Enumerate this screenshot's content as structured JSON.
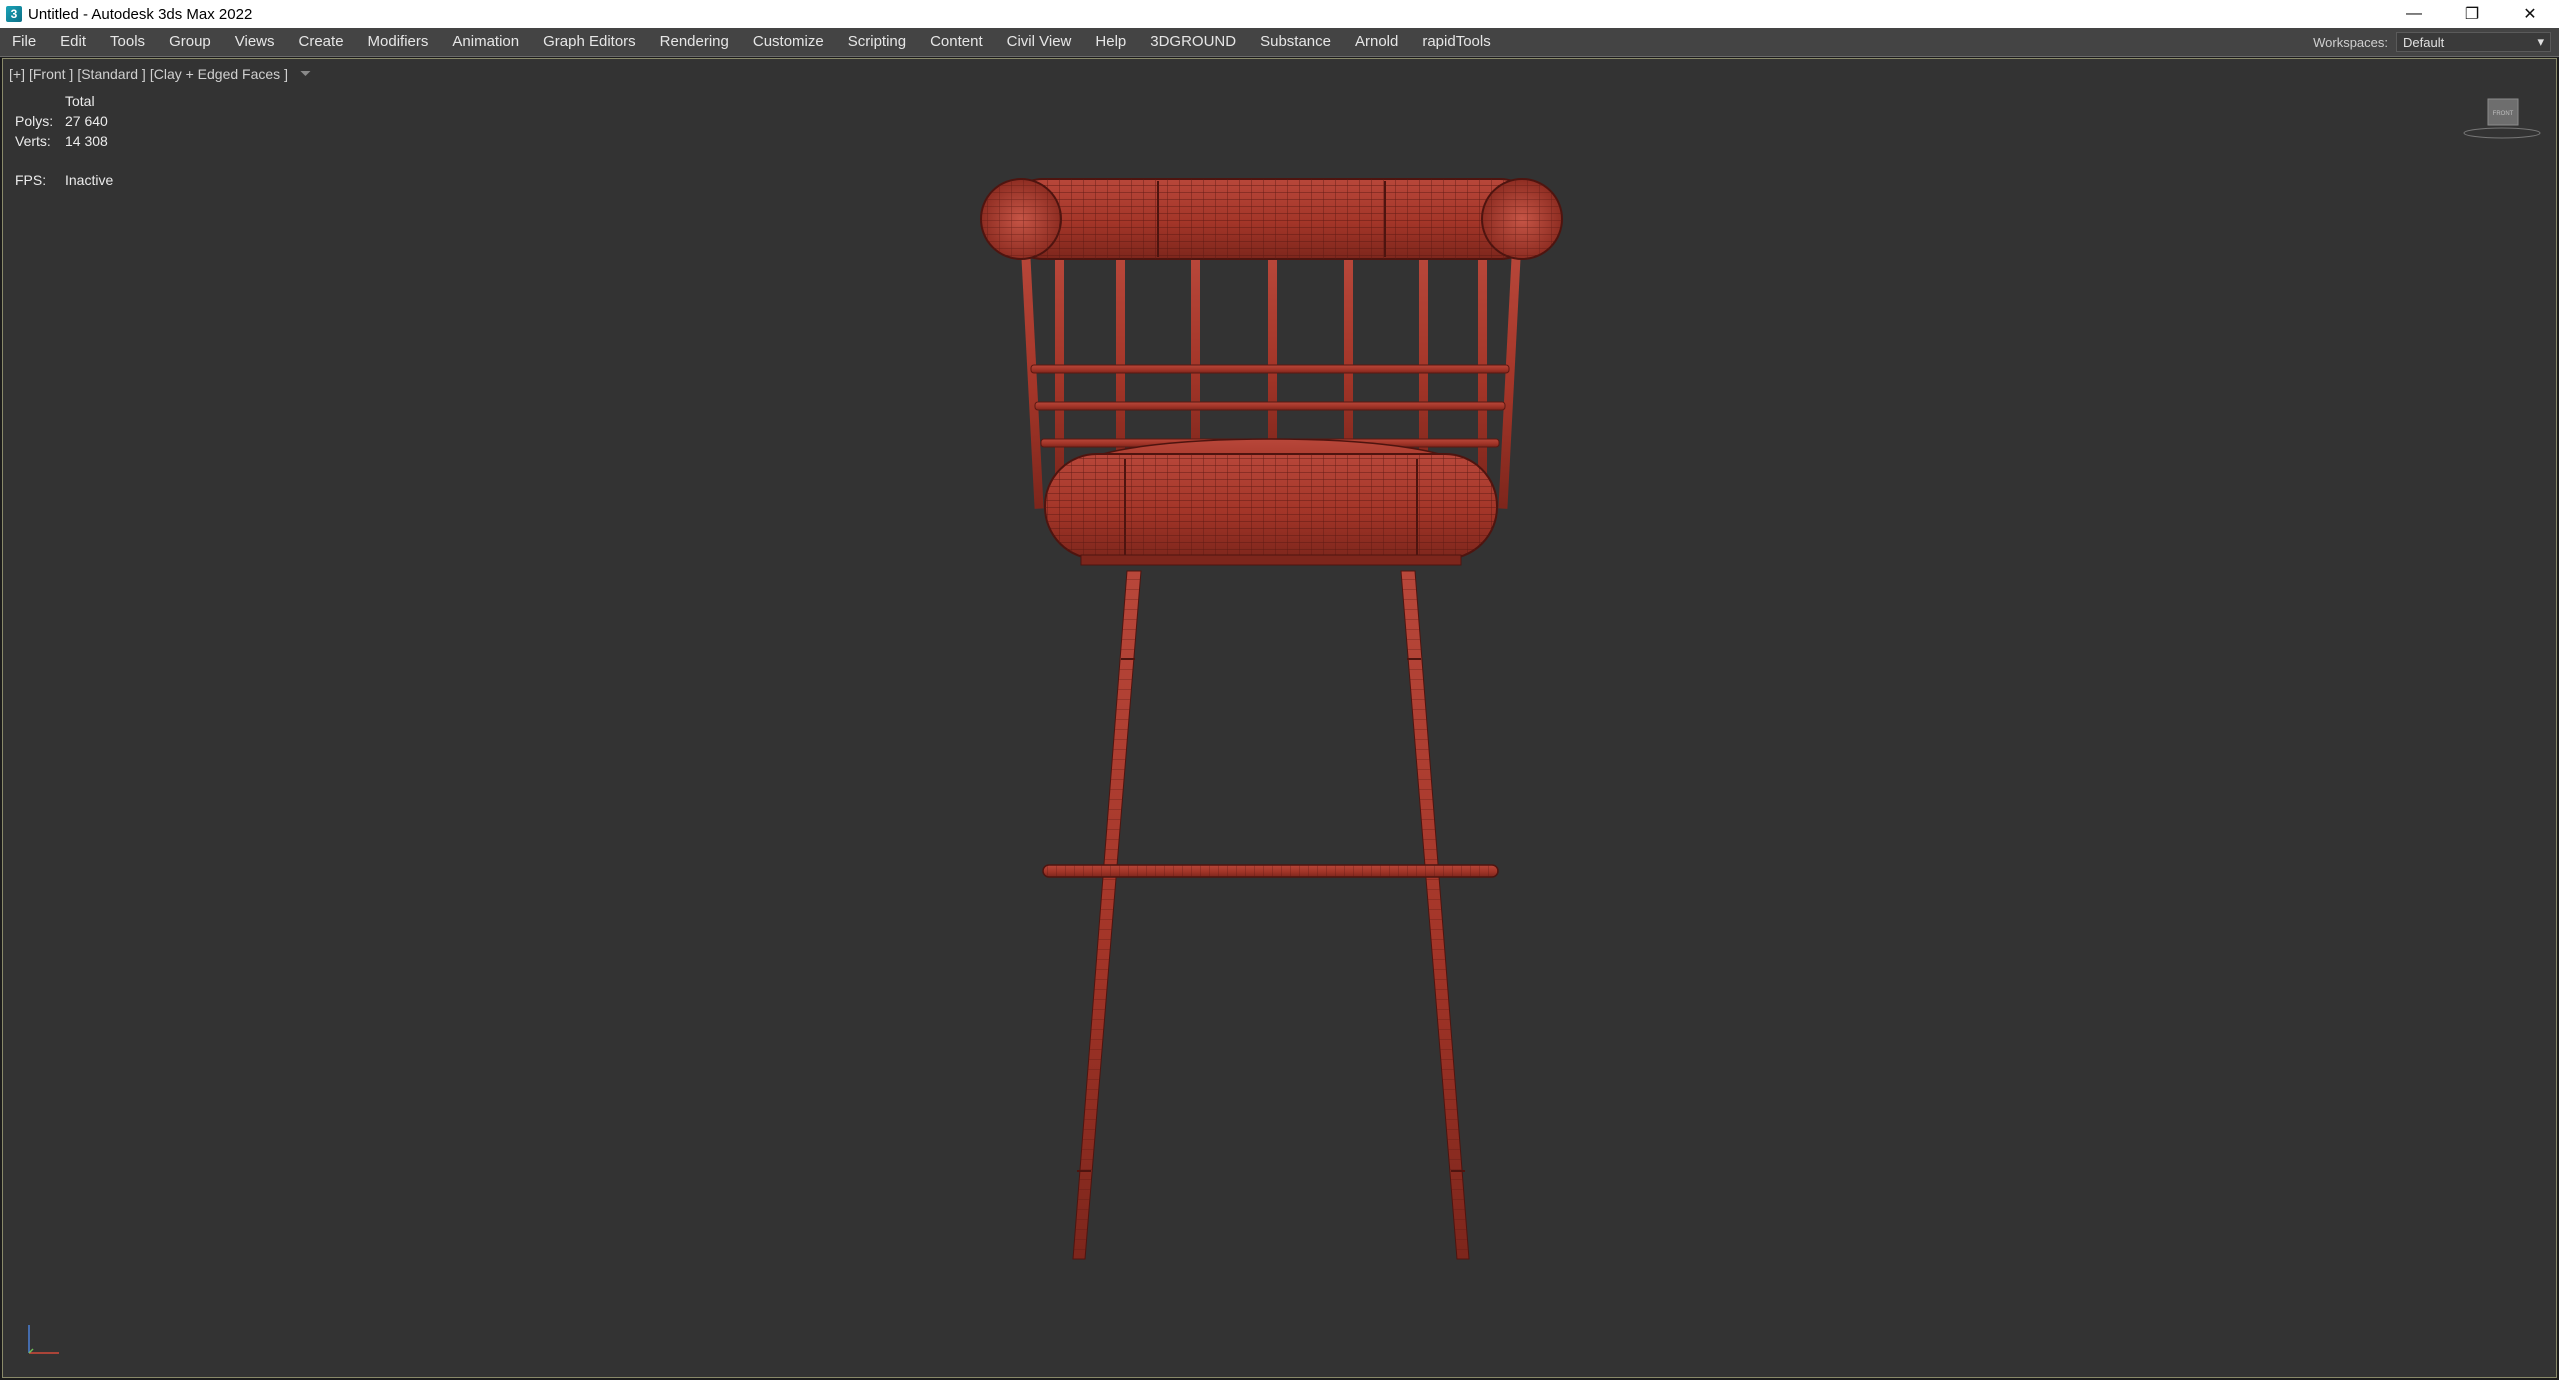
{
  "window": {
    "title": "Untitled - Autodesk 3ds Max 2022",
    "icon": "3ds-max-app-icon",
    "controls": {
      "minimize": "—",
      "restore": "❐",
      "close": "✕"
    }
  },
  "menu": {
    "items": [
      "File",
      "Edit",
      "Tools",
      "Group",
      "Views",
      "Create",
      "Modifiers",
      "Animation",
      "Graph Editors",
      "Rendering",
      "Customize",
      "Scripting",
      "Content",
      "Civil View",
      "Help",
      "3DGROUND",
      "Substance",
      "Arnold",
      "rapidTools"
    ],
    "workspaces_label": "Workspaces:",
    "workspace_value": "Default"
  },
  "viewport": {
    "labels": [
      "[+]",
      "[Front ]",
      "[Standard ]",
      "[Clay + Edged Faces ]"
    ],
    "stats": {
      "header": "Total",
      "polys_label": "Polys:",
      "polys_value": "27 640",
      "verts_label": "Verts:",
      "verts_value": "14 308",
      "fps_label": "FPS:",
      "fps_value": "Inactive"
    },
    "viewcube_face": "FRONT",
    "object": "bar-stool-model",
    "colors": {
      "background": "#333333",
      "model": "#a8382c",
      "wire": "#5a1812"
    }
  }
}
